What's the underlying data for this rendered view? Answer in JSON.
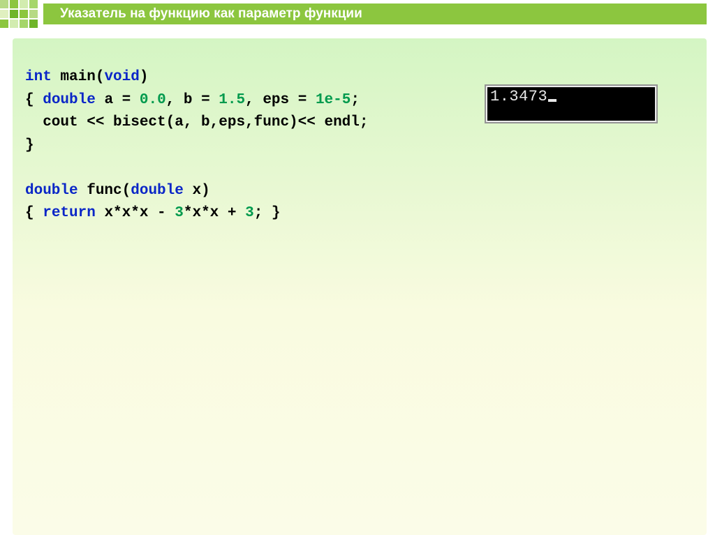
{
  "title": "Указатель на функцию как параметр функции",
  "code": {
    "l1": {
      "a": "int",
      "b": " main(",
      "c": "void",
      "d": ")"
    },
    "l2": {
      "a": "{ ",
      "b": "double",
      "c": " a = ",
      "d": "0.0",
      "e": ", b = ",
      "f": "1.5",
      "g": ", eps = ",
      "h": "1e-5",
      "i": ";"
    },
    "l3": "  cout << bisect(a, b,eps,func)<< endl;",
    "l4": "}",
    "l5": {
      "a": "double",
      "b": " func(",
      "c": "double",
      "d": " x)"
    },
    "l6": {
      "a": "{ ",
      "b": "return",
      "c": " x*x*x - ",
      "d": "3",
      "e": "*x*x + ",
      "f": "3",
      "g": "; }"
    }
  },
  "console_output": "1.3473"
}
